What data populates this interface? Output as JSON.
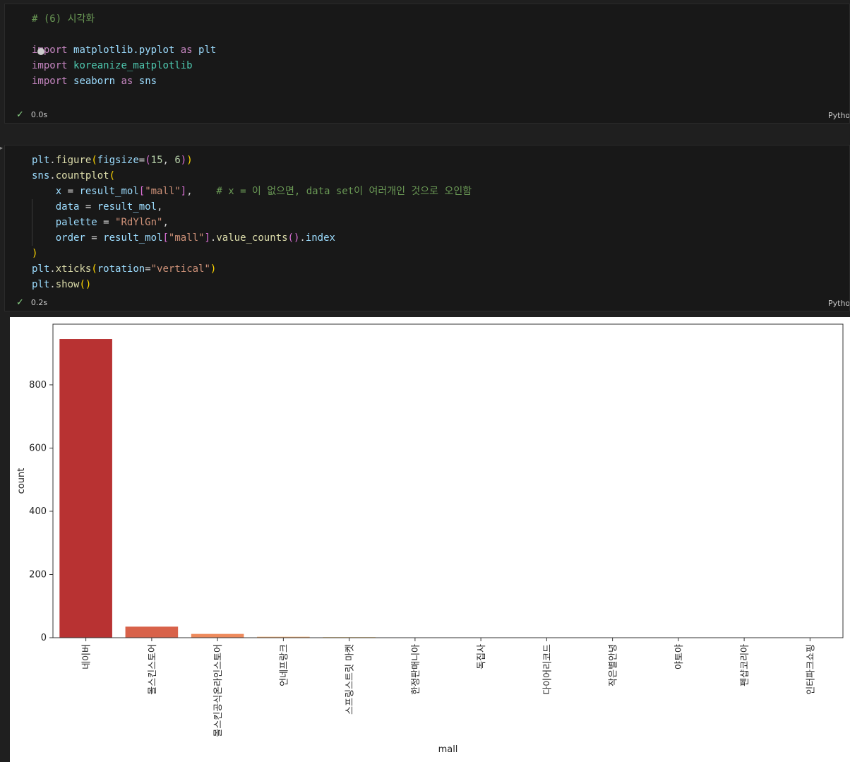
{
  "cells": [
    {
      "status_time": "0.0s",
      "language": "Python",
      "lines": [
        [
          {
            "t": "# (6) 시각화",
            "c": "cmt"
          }
        ],
        [],
        [
          {
            "t": "import",
            "c": "kw"
          },
          {
            "t": " "
          },
          {
            "t": "matplotlib.pyplot",
            "c": "mod"
          },
          {
            "t": " "
          },
          {
            "t": "as",
            "c": "kw"
          },
          {
            "t": " "
          },
          {
            "t": "plt",
            "c": "mod"
          }
        ],
        [
          {
            "t": "import",
            "c": "kw"
          },
          {
            "t": " "
          },
          {
            "t": "koreanize_matplotlib",
            "c": "mod2"
          }
        ],
        [
          {
            "t": "import",
            "c": "kw"
          },
          {
            "t": " "
          },
          {
            "t": "seaborn",
            "c": "mod"
          },
          {
            "t": " "
          },
          {
            "t": "as",
            "c": "kw"
          },
          {
            "t": " "
          },
          {
            "t": "sns",
            "c": "mod"
          }
        ]
      ]
    },
    {
      "status_time": "0.2s",
      "language": "Python",
      "lines": [
        [
          {
            "t": "plt",
            "c": "var"
          },
          {
            "t": "."
          },
          {
            "t": "figure",
            "c": "fn"
          },
          {
            "t": "(",
            "c": "p1"
          },
          {
            "t": "figsize",
            "c": "var"
          },
          {
            "t": "="
          },
          {
            "t": "(",
            "c": "p2"
          },
          {
            "t": "15",
            "c": "num"
          },
          {
            "t": ", "
          },
          {
            "t": "6",
            "c": "num"
          },
          {
            "t": ")",
            "c": "p2"
          },
          {
            "t": ")",
            "c": "p1"
          }
        ],
        [
          {
            "t": "sns",
            "c": "var"
          },
          {
            "t": "."
          },
          {
            "t": "countplot",
            "c": "fn"
          },
          {
            "t": "(",
            "c": "p1"
          }
        ],
        [
          {
            "t": "    "
          },
          {
            "t": "x",
            "c": "var"
          },
          {
            "t": " = "
          },
          {
            "t": "result_mol",
            "c": "var"
          },
          {
            "t": "[",
            "c": "p2"
          },
          {
            "t": "\"mall\"",
            "c": "str"
          },
          {
            "t": "]",
            "c": "p2"
          },
          {
            "t": ",    "
          },
          {
            "t": "# x = 이 없으면, data set이 여러개인 것으로 오인함",
            "c": "cmt"
          }
        ],
        [
          {
            "t": "    "
          },
          {
            "t": "data",
            "c": "var"
          },
          {
            "t": " = "
          },
          {
            "t": "result_mol",
            "c": "var"
          },
          {
            "t": ","
          }
        ],
        [
          {
            "t": "    "
          },
          {
            "t": "palette",
            "c": "var"
          },
          {
            "t": " = "
          },
          {
            "t": "\"RdYlGn\"",
            "c": "str"
          },
          {
            "t": ","
          }
        ],
        [
          {
            "t": "    "
          },
          {
            "t": "order",
            "c": "var"
          },
          {
            "t": " = "
          },
          {
            "t": "result_mol",
            "c": "var"
          },
          {
            "t": "[",
            "c": "p2"
          },
          {
            "t": "\"mall\"",
            "c": "str"
          },
          {
            "t": "]",
            "c": "p2"
          },
          {
            "t": "."
          },
          {
            "t": "value_counts",
            "c": "fn"
          },
          {
            "t": "()",
            "c": "p2"
          },
          {
            "t": "."
          },
          {
            "t": "index",
            "c": "var"
          }
        ],
        [
          {
            "t": ")",
            "c": "p1"
          }
        ],
        [
          {
            "t": "plt",
            "c": "var"
          },
          {
            "t": "."
          },
          {
            "t": "xticks",
            "c": "fn"
          },
          {
            "t": "(",
            "c": "p1"
          },
          {
            "t": "rotation",
            "c": "var"
          },
          {
            "t": "="
          },
          {
            "t": "\"vertical\"",
            "c": "str"
          },
          {
            "t": ")",
            "c": "p1"
          }
        ],
        [
          {
            "t": "plt",
            "c": "var"
          },
          {
            "t": "."
          },
          {
            "t": "show",
            "c": "fn"
          },
          {
            "t": "()",
            "c": "p1"
          }
        ]
      ]
    }
  ],
  "chart_data": {
    "type": "bar",
    "categories": [
      "네이버",
      "몰스킨스토어",
      "몰스킨공식온라인스토어",
      "언네프랑크",
      "스프링스트릿 마켓",
      "한정판매니아",
      "독집사",
      "다이어리코드",
      "작은별안녕",
      "야토야",
      "펜샵코리아",
      "인터파크쇼핑"
    ],
    "values": [
      945,
      35,
      12,
      3,
      2,
      1,
      1,
      1,
      1,
      1,
      1,
      1
    ],
    "colors": [
      "#b83232",
      "#d8624a",
      "#ee8a5c",
      "#f9b170",
      "#fdd38a",
      "#fdf0a6",
      "#f0f8a9",
      "#d5ee97",
      "#aedb80",
      "#7cc36b",
      "#3ea355",
      "#168a47"
    ],
    "xlabel": "mall",
    "ylabel": "count",
    "yticks": [
      0,
      200,
      400,
      600,
      800
    ],
    "ylim": [
      0,
      992
    ],
    "grid": false
  }
}
